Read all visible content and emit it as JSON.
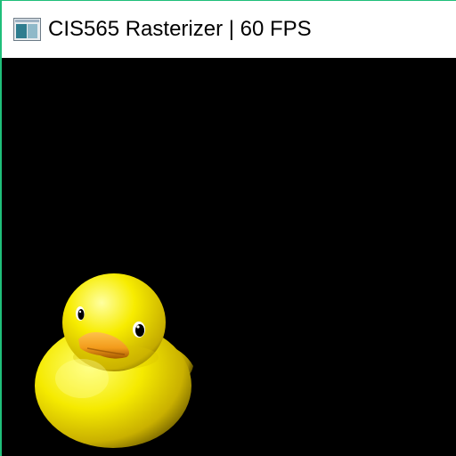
{
  "window": {
    "title": "CIS565 Rasterizer | 60 FPS",
    "icon": "application-window-icon",
    "border_color": "#1fbf7a"
  },
  "viewport": {
    "background": "#000000",
    "scene": "yellow-rubber-duck",
    "duck_color": "#f2e600",
    "beak_color": "#f29a1a"
  }
}
